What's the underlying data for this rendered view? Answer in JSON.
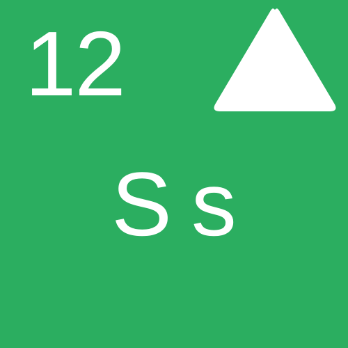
{
  "card": {
    "number": "12",
    "letters": {
      "upper": "S",
      "lower": "s"
    },
    "icon": "triangle-up-icon",
    "colors": {
      "background": "#2BAE60",
      "foreground": "#FFFFFF"
    }
  }
}
